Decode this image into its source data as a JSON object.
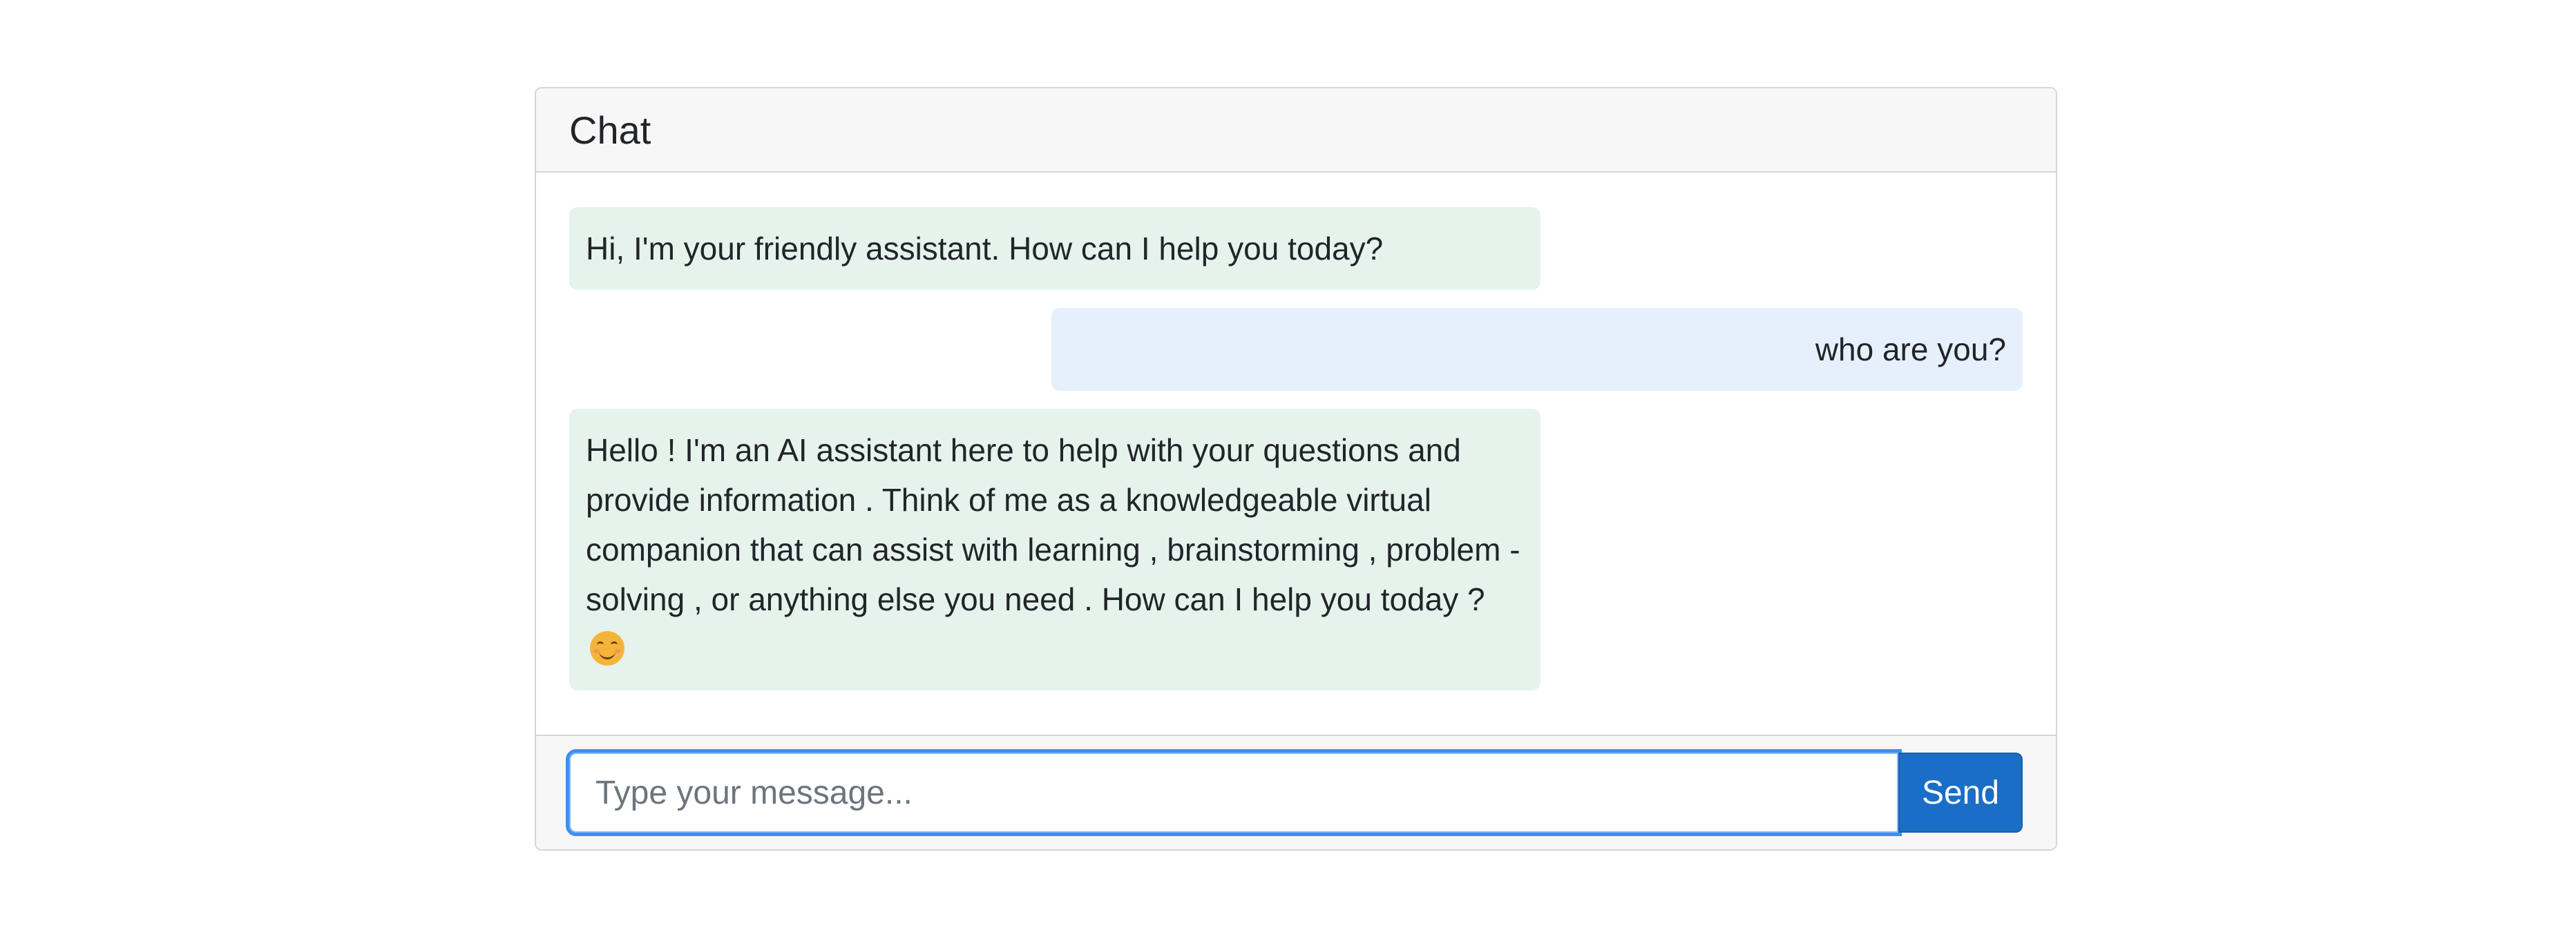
{
  "chat": {
    "title": "Chat",
    "messages": [
      {
        "role": "assistant",
        "text": "Hi, I'm your friendly assistant. How can I help you today?"
      },
      {
        "role": "user",
        "text": "who are you?"
      },
      {
        "role": "assistant",
        "text": "Hello ! I'm an AI assistant here to help with your questions and provide information . Think of me as a knowledgeable virtual companion that can assist with learning , brainstorming , problem -solving , or anything else you need . How can I help you today ?",
        "emoji": "smiling-face-icon"
      }
    ],
    "input": {
      "placeholder": "Type your message...",
      "value": ""
    },
    "send_label": "Send"
  },
  "colors": {
    "assistant_bubble": "#e6f2ec",
    "user_bubble": "#e6f0fc",
    "send_button": "#1a6ec5",
    "focus_ring": "#3d8ef0"
  }
}
